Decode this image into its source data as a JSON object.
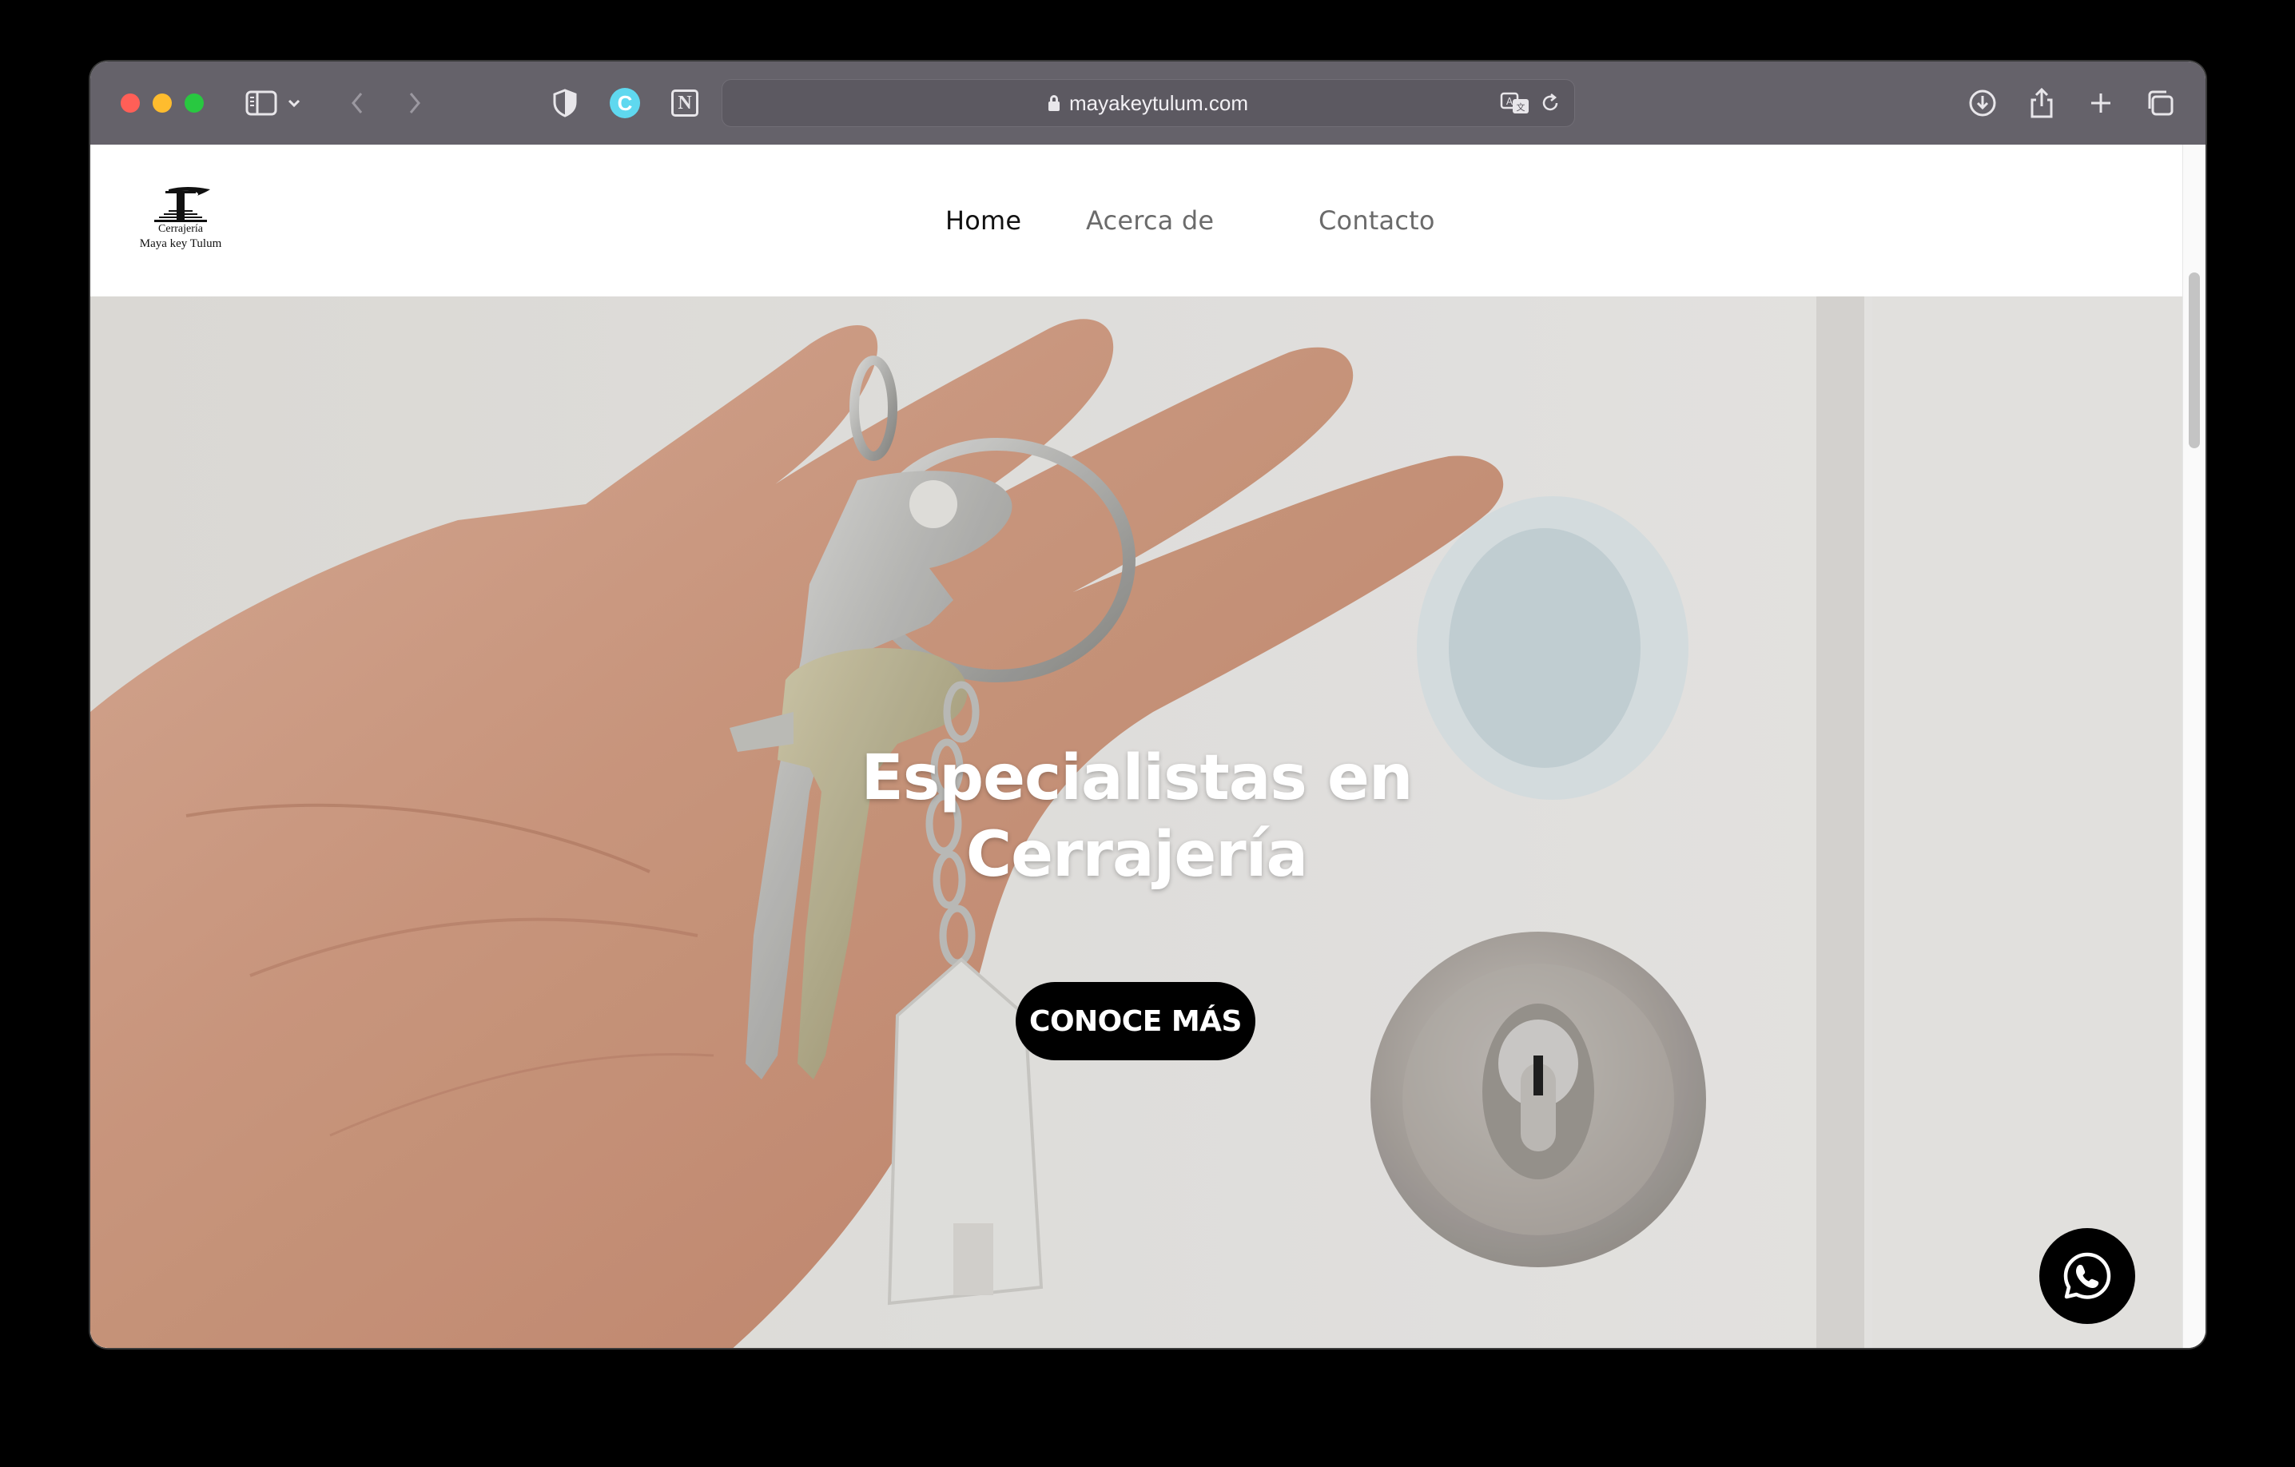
{
  "browser": {
    "url": "mayakeytulum.com",
    "extension_c_label": "C",
    "extension_n_label": "N",
    "icons": [
      "sidebar-icon",
      "chevron-down-icon",
      "back-icon",
      "forward-icon",
      "privacy-shield-icon",
      "translate-icon",
      "reload-icon",
      "download-icon",
      "share-icon",
      "new-tab-icon",
      "tabs-overview-icon",
      "lock-icon"
    ]
  },
  "site": {
    "logo": {
      "line1": "Cerrajería",
      "line2": "Maya key Tulum"
    },
    "nav": {
      "home": "Home",
      "about": "Acerca de",
      "contact": "Contacto",
      "active": "Home"
    },
    "hero": {
      "title_line1": "Especialistas en",
      "title_line2": "Cerrajería",
      "cta_label": "CONOCE MÁS"
    },
    "floating_button_icon": "whatsapp-icon"
  },
  "colors": {
    "titlebar": "#65626a",
    "cta_background": "#000000",
    "cta_text": "#ffffff",
    "nav_active": "#111111",
    "nav_inactive": "#6b6b6b"
  }
}
